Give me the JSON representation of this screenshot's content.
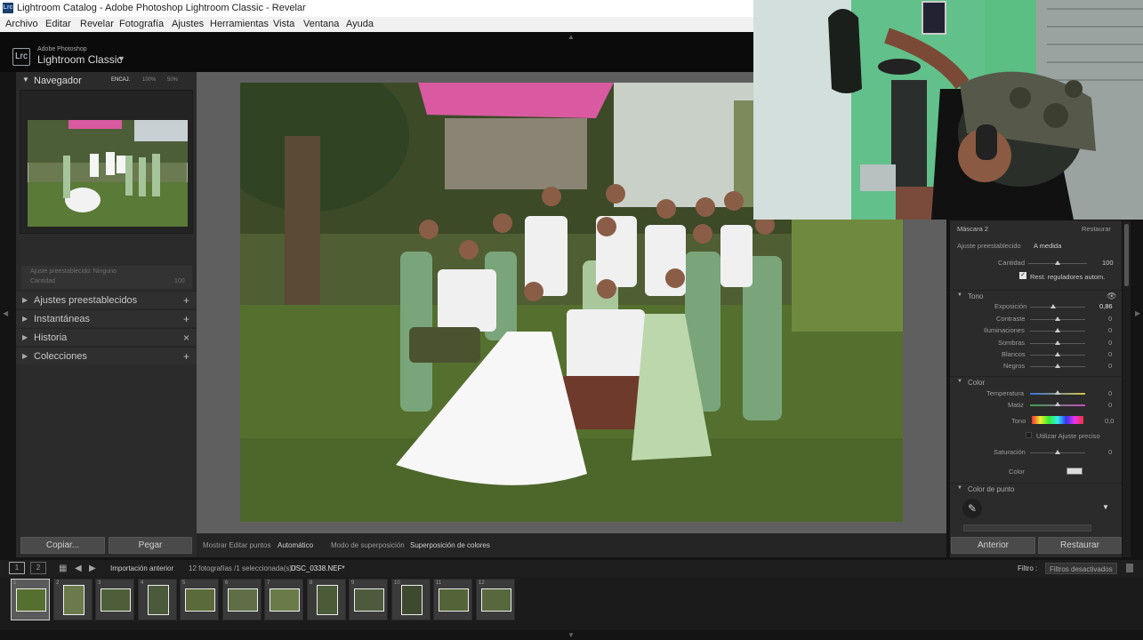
{
  "window": {
    "title": "Lightroom Catalog - Adobe Photoshop Lightroom Classic - Revelar",
    "app_icon": "Lrc"
  },
  "menu": [
    "Archivo",
    "Editar",
    "Revelar",
    "Fotografía",
    "Ajustes",
    "Herramientas",
    "Vista",
    "Ventana",
    "Ayuda"
  ],
  "identity": {
    "badge": "Lrc",
    "vendor": "Adobe Photoshop",
    "product": "Lightroom Classic"
  },
  "navigator": {
    "title": "Navegador",
    "zoom_options": [
      "ENCAJ.",
      "100%",
      "50%"
    ]
  },
  "left_panel": {
    "preset_amount_label": "Ajuste preestablecido: Ninguno",
    "amount_label": "Cantidad",
    "amount_value": "100",
    "rows": [
      {
        "label": "Ajustes preestablecidos",
        "action": "+"
      },
      {
        "label": "Instantáneas",
        "action": "+"
      },
      {
        "label": "Historia",
        "action": "×"
      },
      {
        "label": "Colecciones",
        "action": "+"
      }
    ],
    "copy_label": "Copiar...",
    "paste_label": "Pegar"
  },
  "toolbar": {
    "show_edit_points": "Mostrar Editar puntos",
    "auto": "Automático",
    "overlay_mode": "Modo de superposición",
    "overlay_color": "Superposición de colores"
  },
  "mask_panel": {
    "title": "Máscara 2",
    "reset": "Restaurar",
    "preset_label": "Ajuste preestablecido",
    "preset_value": "A medida",
    "amount_label": "Cantidad",
    "amount_value": "100",
    "auto_reset": "Rest. reguladores autom.",
    "auto_reset_checked": true,
    "tone_section": "Tono",
    "tone": [
      {
        "label": "Exposición",
        "value": "0,86",
        "level": 0.0
      },
      {
        "label": "Contraste",
        "value": "0"
      },
      {
        "label": "Iluminaciones",
        "value": "0"
      },
      {
        "label": "Sombras",
        "value": "0"
      },
      {
        "label": "Blancos",
        "value": "0"
      },
      {
        "label": "Negros",
        "value": "0"
      }
    ],
    "color_section": "Color",
    "color": [
      {
        "label": "Temperatura",
        "value": "0"
      },
      {
        "label": "Matiz",
        "value": "0"
      },
      {
        "label": "Tono",
        "value": "0,0"
      }
    ],
    "fine_adjust": "Utilizar Ajuste preciso",
    "saturation_label": "Saturación",
    "saturation_value": "0",
    "color_label": "Color",
    "point_color_section": "Color de punto",
    "prev_button": "Anterior",
    "reset_button": "Restaurar"
  },
  "filmbar": {
    "source": "Importación anterior",
    "count": "12 fotografías /1 seleccionada(s) /",
    "filename": "DSC_0338.NEF",
    "filter_label": "Filtro :",
    "filter_value": "Filtros desactivados"
  },
  "thumbnails": [
    {
      "num": "1"
    },
    {
      "num": "2"
    },
    {
      "num": "3"
    },
    {
      "num": "4"
    },
    {
      "num": "5"
    },
    {
      "num": "6"
    },
    {
      "num": "7"
    },
    {
      "num": "8"
    },
    {
      "num": "9"
    },
    {
      "num": "10"
    },
    {
      "num": "11"
    },
    {
      "num": "12"
    }
  ],
  "colors": {
    "accent": "#c9c9c9",
    "panel": "#2b2b2b",
    "pink_roof": "#d95aa0"
  }
}
